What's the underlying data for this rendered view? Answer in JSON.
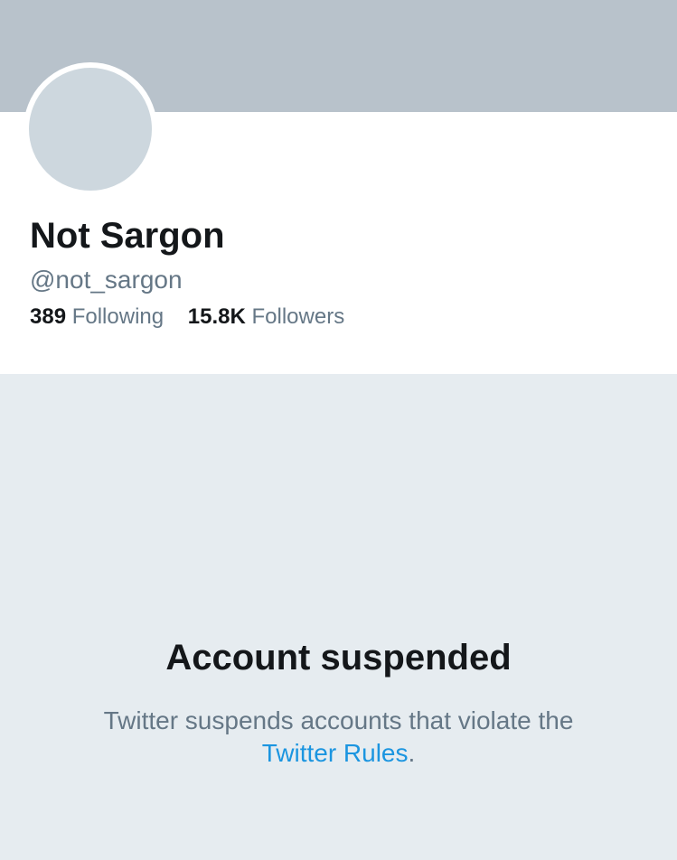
{
  "profile": {
    "display_name": "Not Sargon",
    "handle": "@not_sargon",
    "following_count": "389",
    "following_label": "Following",
    "followers_count": "15.8K",
    "followers_label": "Followers"
  },
  "suspension": {
    "title": "Account suspended",
    "message_prefix": "Twitter suspends accounts that violate the",
    "link_text": "Twitter Rules",
    "message_suffix": "."
  },
  "colors": {
    "banner": "#b8c2cb",
    "avatar": "#cdd7de",
    "page_background": "#e6ecf0",
    "link": "#1b95e0",
    "primary_text": "#14171a",
    "secondary_text": "#657786"
  }
}
